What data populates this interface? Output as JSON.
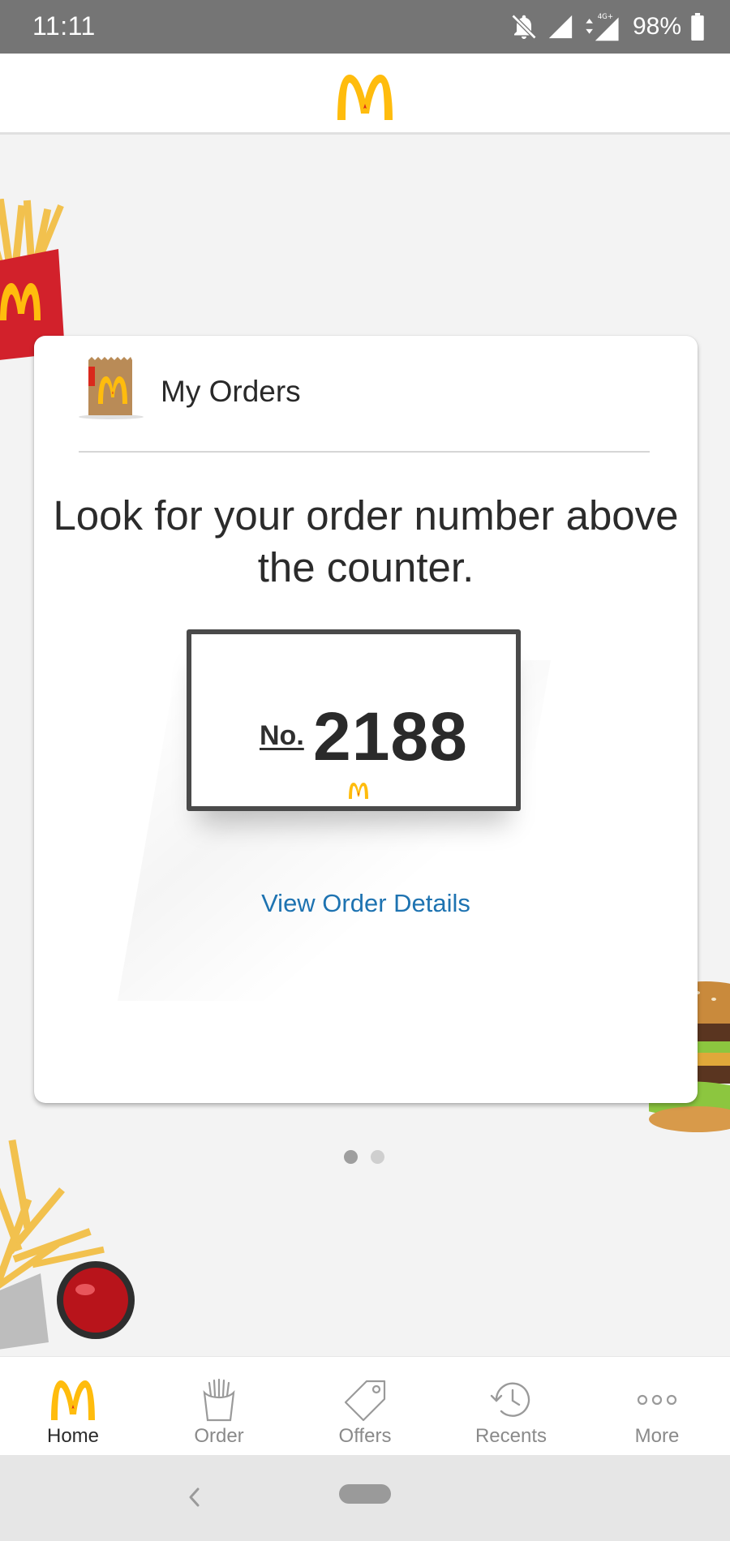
{
  "status_bar": {
    "time": "11:11",
    "battery_percent": "98%",
    "network_label": "4G+",
    "icons": [
      "notifications-off-icon",
      "signal-icon",
      "mobile-data-icon",
      "battery-icon"
    ]
  },
  "header": {
    "logo_icon": "golden-arches-icon"
  },
  "card": {
    "icon": "paper-bag-icon",
    "title": "My Orders",
    "message": "Look for your order number above the counter.",
    "order_prefix": "No.",
    "order_number": "2188",
    "view_details_label": "View Order Details"
  },
  "pager": {
    "total": 2,
    "active_index": 0
  },
  "bottom_nav": {
    "items": [
      {
        "label": "Home",
        "icon": "golden-arches-icon",
        "active": true
      },
      {
        "label": "Order",
        "icon": "fries-box-icon",
        "active": false
      },
      {
        "label": "Offers",
        "icon": "price-tag-icon",
        "active": false
      },
      {
        "label": "Recents",
        "icon": "history-clock-icon",
        "active": false
      },
      {
        "label": "More",
        "icon": "more-dots-icon",
        "active": false
      }
    ]
  },
  "colors": {
    "brand_yellow": "#FFBC0D",
    "brand_red": "#DA291C",
    "link_blue": "#1E73B1",
    "status_bar_gray": "#757575"
  }
}
